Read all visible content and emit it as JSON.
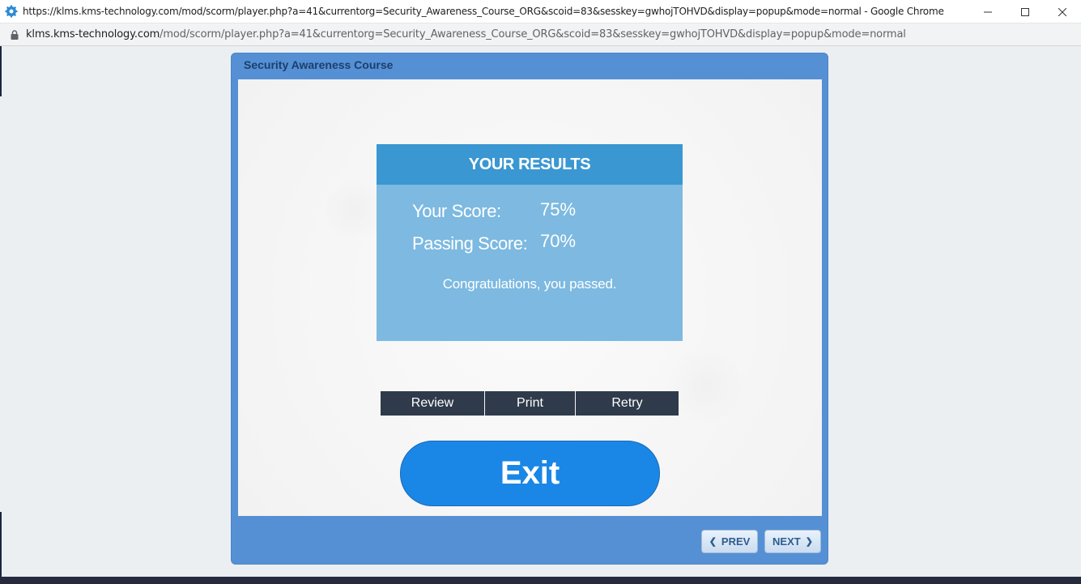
{
  "window": {
    "title": "https://klms.kms-technology.com/mod/scorm/player.php?a=41&currentorg=Security_Awareness_Course_ORG&scoid=83&sesskey=gwhojTOHVD&display=popup&mode=normal - Google Chrome"
  },
  "address": {
    "host": "klms.kms-technology.com",
    "path": "/mod/scorm/player.php?a=41&currentorg=Security_Awareness_Course_ORG&scoid=83&sesskey=gwhojTOHVD&display=popup&mode=normal"
  },
  "player": {
    "course_title": "Security Awareness Course"
  },
  "results": {
    "header": "YOUR RESULTS",
    "your_score_label": "Your Score:",
    "your_score_value": "75%",
    "passing_score_label": "Passing Score:",
    "passing_score_value": "70%",
    "message": "Congratulations, you passed."
  },
  "actions": {
    "review": "Review",
    "print": "Print",
    "retry": "Retry",
    "exit": "Exit"
  },
  "nav": {
    "prev": "PREV",
    "next": "NEXT"
  },
  "colors": {
    "player_frame": "#5590d4",
    "results_header": "#3a97d2",
    "results_body": "#7db9e0",
    "action_buttons": "#2f3b4b",
    "exit_button": "#1a87e6"
  }
}
